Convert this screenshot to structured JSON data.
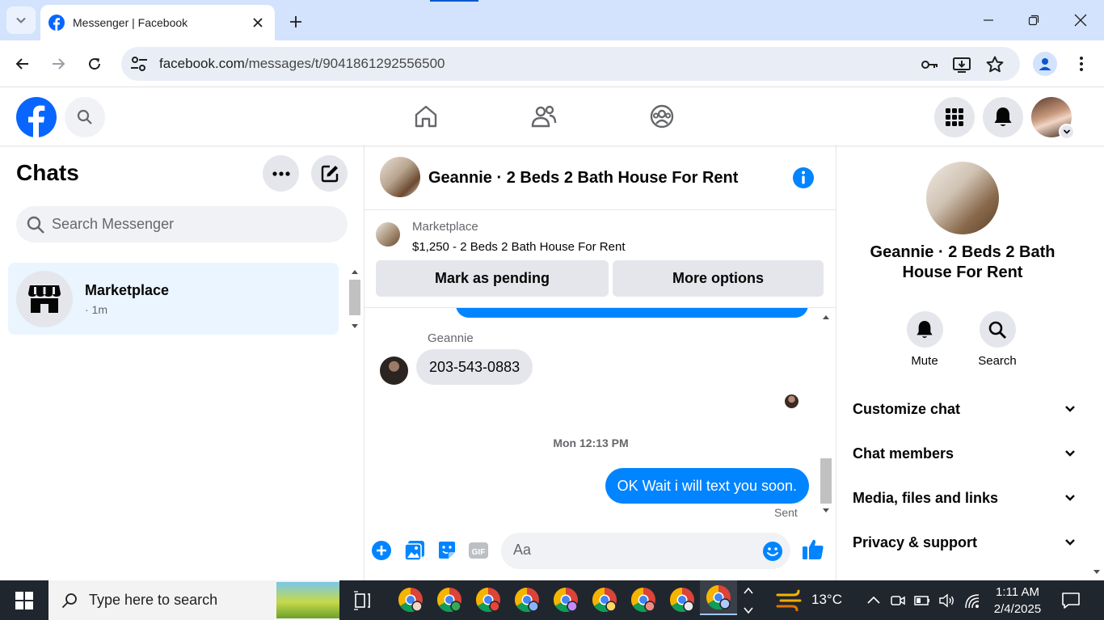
{
  "browser": {
    "tab_title": "Messenger | Facebook",
    "url_host": "facebook.com",
    "url_path": "/messages/t/9041861292556500"
  },
  "chats": {
    "title": "Chats",
    "search_placeholder": "Search Messenger",
    "items": [
      {
        "name": "Marketplace",
        "time": "· 1m"
      }
    ]
  },
  "conversation": {
    "title": "Geannie · 2 Beds 2 Bath House For Rent",
    "marketplace_label": "Marketplace",
    "listing": "$1,250 - 2 Beds 2 Bath House For Rent",
    "mark_pending_label": "Mark as pending",
    "more_options_label": "More options",
    "sender_name": "Geannie",
    "incoming_message": "203-543-0883",
    "timestamp": "Mon 12:13 PM",
    "outgoing_message": "OK Wait i will text you soon.",
    "status": "Sent",
    "composer_placeholder": "Aa"
  },
  "info_panel": {
    "name": "Geannie · 2 Beds 2 Bath House For Rent",
    "actions": [
      {
        "label": "Mute",
        "icon": "bell-icon"
      },
      {
        "label": "Search",
        "icon": "search-icon"
      }
    ],
    "sections": [
      "Customize chat",
      "Chat members",
      "Media, files and links",
      "Privacy & support"
    ]
  },
  "taskbar": {
    "search_placeholder": "Type here to search",
    "temperature": "13°C",
    "time": "1:11 AM",
    "date": "2/4/2025"
  },
  "colors": {
    "facebook_blue": "#0866ff",
    "messenger_blue": "#0084ff",
    "selected_chat_bg": "#ebf5ff",
    "tabstrip_bg": "#d3e3fd"
  }
}
